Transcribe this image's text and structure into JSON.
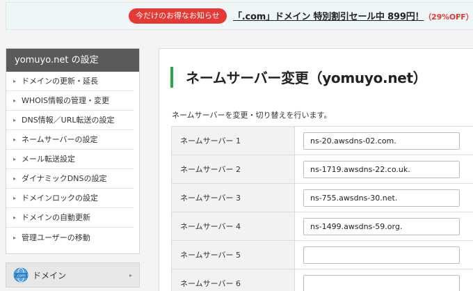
{
  "promo": {
    "badge": "今だけのお得なお知らせ",
    "text_main": "「.com」ドメイン 特別割引セール中 899円！",
    "text_discount": "（29%OFF）",
    "chevron": "›"
  },
  "sidebar": {
    "header": "yomuyo.net の設定",
    "items": [
      {
        "label": "ドメインの更新・延長"
      },
      {
        "label": "WHOIS情報の管理・変更"
      },
      {
        "label": "DNS情報／URL転送の設定"
      },
      {
        "label": "ネームサーバーの設定"
      },
      {
        "label": "メール転送設定"
      },
      {
        "label": "ダイナミックDNSの設定"
      },
      {
        "label": "ドメインロックの設定"
      },
      {
        "label": "ドメインの自動更新"
      },
      {
        "label": "管理ユーザーの移動"
      }
    ],
    "domain_nav": {
      "label": "ドメイン",
      "icon_text": ".com"
    }
  },
  "main": {
    "title": "ネームサーバー変更（yomuyo.net）",
    "description": "ネームサーバーを変更・切り替えを行います。",
    "rows": [
      {
        "label": "ネームサーバー 1",
        "value": "ns-20.awsdns-02.com."
      },
      {
        "label": "ネームサーバー 2",
        "value": "ns-1719.awsdns-22.co.uk."
      },
      {
        "label": "ネームサーバー 3",
        "value": "ns-755.awsdns-30.net."
      },
      {
        "label": "ネームサーバー 4",
        "value": "ns-1499.awsdns-59.org."
      },
      {
        "label": "ネームサーバー 5",
        "value": ""
      },
      {
        "label": "ネームサーバー 6",
        "value": ""
      }
    ]
  },
  "colors": {
    "accent_green": "#2aa84a",
    "promo_red": "#e53935",
    "sidebar_header": "#5a5a5a"
  }
}
